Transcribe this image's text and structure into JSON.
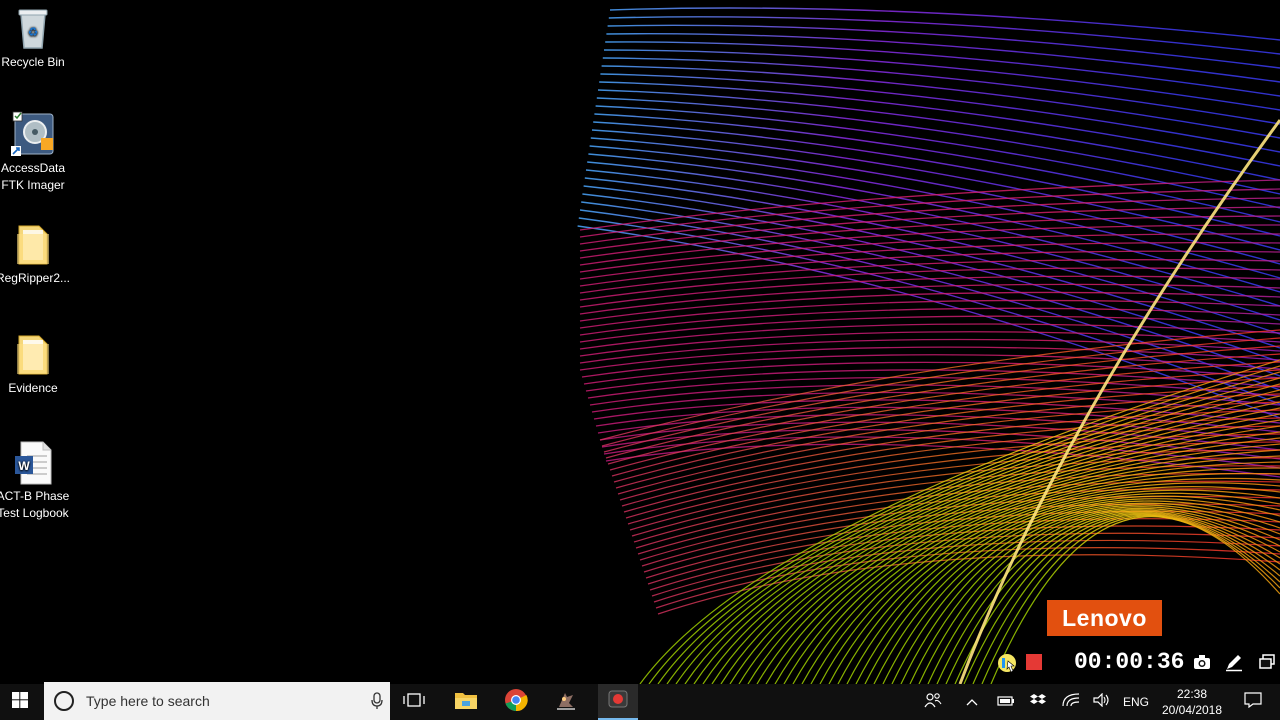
{
  "desktop": {
    "icons": [
      {
        "label": "Recycle Bin",
        "icon": "recycle-bin-icon"
      },
      {
        "label": "AccessData\nFTK Imager",
        "icon": "ftk-imager-icon"
      },
      {
        "label": "RegRipper2...",
        "icon": "folder-icon"
      },
      {
        "label": "Evidence",
        "icon": "folder-icon"
      },
      {
        "label": "ACT-B Phase\nTest Logbook",
        "icon": "word-document-icon"
      }
    ],
    "brand_badge": "Lenovo"
  },
  "recorder": {
    "elapsed": "00:00:36",
    "controls": [
      "pause-icon",
      "stop-icon",
      "camera-icon",
      "pen-icon",
      "window-icon"
    ]
  },
  "taskbar": {
    "search_placeholder": "Type here to search",
    "pinned": [
      "task-view-icon",
      "file-explorer-icon",
      "chrome-icon",
      "app-icon",
      "screen-recorder-icon"
    ],
    "tray": {
      "language": "ENG",
      "time": "22:38",
      "date": "20/04/2018"
    }
  },
  "colors": {
    "taskbar": "#101010",
    "search_bg": "#f2f2f2",
    "lenovo": "#e2500f",
    "stop": "#e53935"
  }
}
